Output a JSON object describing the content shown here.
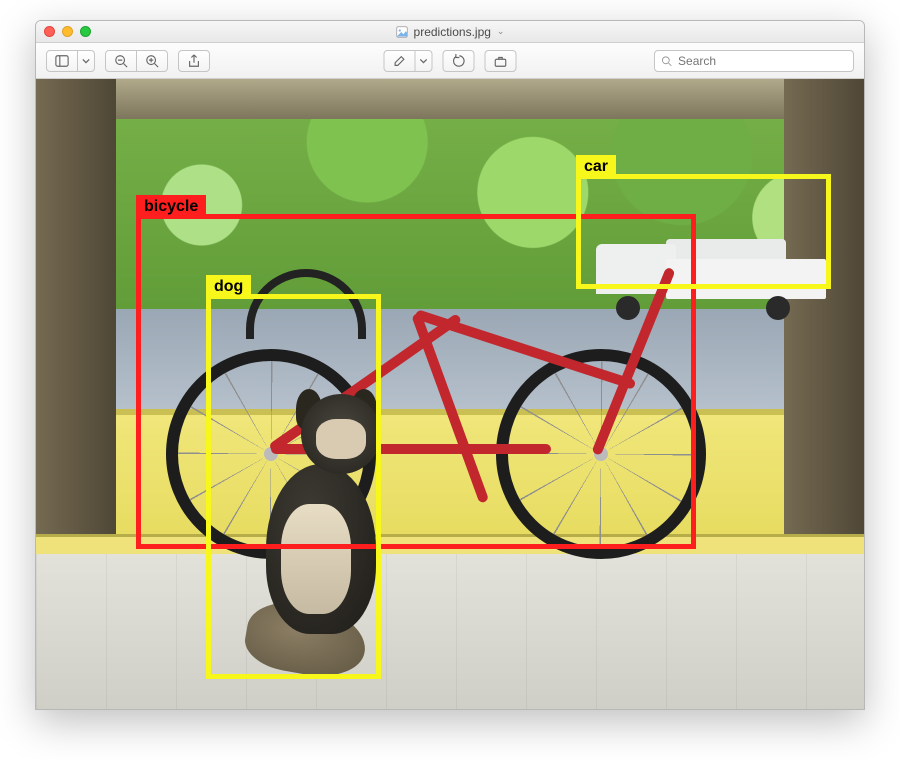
{
  "window": {
    "filename": "predictions.jpg",
    "title_chevron": "⌄"
  },
  "toolbar": {
    "search_placeholder": "Search"
  },
  "icons": {
    "sidebar": "sidebar-icon",
    "zoom_out": "zoom-out-icon",
    "zoom_in": "zoom-in-icon",
    "share": "share-icon",
    "markup": "markup-icon",
    "markup_chevron": "chevron-down-icon",
    "rotate": "rotate-left-icon",
    "toolbox": "toolbox-icon",
    "search": "search-icon",
    "file": "image-file-icon"
  },
  "detections": {
    "bicycle": {
      "label": "bicycle",
      "color": "red"
    },
    "dog": {
      "label": "dog",
      "color": "yellow"
    },
    "car": {
      "label": "car",
      "color": "yellow"
    }
  }
}
